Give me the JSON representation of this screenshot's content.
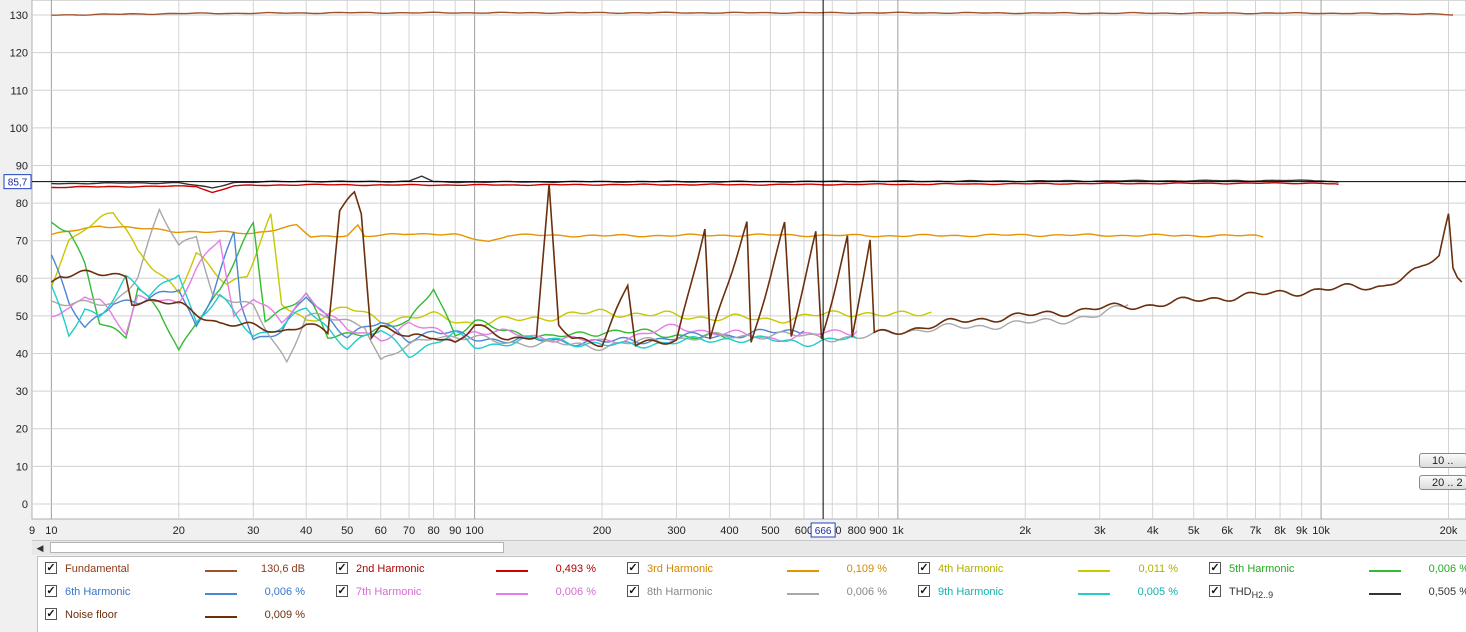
{
  "chart_data": {
    "type": "line",
    "x_scale": "log",
    "xlim": [
      9,
      22000
    ],
    "ylim": [
      -4,
      134
    ],
    "grid": true,
    "y_ticks": [
      "0",
      "10",
      "20",
      "30",
      "40",
      "50",
      "60",
      "70",
      "80",
      "90",
      "100",
      "110",
      "120",
      "130"
    ],
    "x_ticks": [
      "9",
      "10",
      "20",
      "30",
      "40",
      "50",
      "60",
      "70",
      "80",
      "90",
      "100",
      "200",
      "300",
      "400",
      "500",
      "600",
      "700",
      "800",
      "900",
      "1k",
      "2k",
      "3k",
      "4k",
      "5k",
      "6k",
      "7k",
      "8k",
      "9k",
      "10k",
      "20k"
    ],
    "cursor": {
      "x": 666,
      "y": 85.7,
      "x_label": "666",
      "y_label": "85,7"
    },
    "series": [
      {
        "name": "Fundamental",
        "color": "#a0522d",
        "value": "130,6 dB",
        "points": [
          [
            10,
            130
          ],
          [
            20,
            130.4
          ],
          [
            50,
            130.6
          ],
          [
            100,
            130.6
          ],
          [
            300,
            130.6
          ],
          [
            1000,
            130.6
          ],
          [
            3000,
            130.5
          ],
          [
            10000,
            130.5
          ],
          [
            18000,
            130.3
          ],
          [
            20500,
            130
          ]
        ]
      },
      {
        "name": "2nd Harmonic",
        "color": "#cc0000",
        "value": "0,493 %",
        "points": [
          [
            10,
            84.2
          ],
          [
            15,
            84.4
          ],
          [
            22,
            84.5
          ],
          [
            24,
            82.8
          ],
          [
            27,
            84.6
          ],
          [
            40,
            84.9
          ],
          [
            60,
            84.8
          ],
          [
            100,
            84.8
          ],
          [
            200,
            84.9
          ],
          [
            500,
            84.9
          ],
          [
            1000,
            85
          ],
          [
            3000,
            85.2
          ],
          [
            10000,
            85.3
          ],
          [
            11000,
            85
          ]
        ]
      },
      {
        "name": "3rd Harmonic",
        "color": "#e59400",
        "value": "0,109 %",
        "points": [
          [
            10,
            71.5
          ],
          [
            13,
            74
          ],
          [
            20,
            72.5
          ],
          [
            30,
            72
          ],
          [
            38,
            74
          ],
          [
            41,
            71
          ],
          [
            50,
            71.5
          ],
          [
            53,
            74
          ],
          [
            55,
            71
          ],
          [
            70,
            72
          ],
          [
            90,
            71.5
          ],
          [
            108,
            69.8
          ],
          [
            120,
            71.5
          ],
          [
            200,
            71.3
          ],
          [
            500,
            71.5
          ],
          [
            1000,
            71.3
          ],
          [
            2000,
            71.5
          ],
          [
            4000,
            71.4
          ],
          [
            7000,
            71.3
          ],
          [
            7300,
            71
          ]
        ]
      },
      {
        "name": "4th Harmonic",
        "color": "#c8c800",
        "value": "0,011 %",
        "points": [
          [
            10,
            58
          ],
          [
            11,
            70
          ],
          [
            12,
            74
          ],
          [
            14,
            77
          ],
          [
            15,
            73
          ],
          [
            16,
            67
          ],
          [
            18,
            62
          ],
          [
            20,
            56
          ],
          [
            22,
            66
          ],
          [
            26,
            59
          ],
          [
            29,
            61
          ],
          [
            33,
            76
          ],
          [
            35,
            53
          ],
          [
            40,
            49
          ],
          [
            50,
            52
          ],
          [
            60,
            49
          ],
          [
            80,
            50
          ],
          [
            100,
            48
          ],
          [
            200,
            51
          ],
          [
            300,
            50
          ],
          [
            500,
            49
          ],
          [
            800,
            51
          ],
          [
            1000,
            50
          ],
          [
            1200,
            51
          ]
        ]
      },
      {
        "name": "5th Harmonic",
        "color": "#33bb33",
        "value": "0,006 %",
        "points": [
          [
            10,
            75
          ],
          [
            11,
            73
          ],
          [
            12,
            63
          ],
          [
            13,
            48
          ],
          [
            15,
            45
          ],
          [
            16,
            58
          ],
          [
            18,
            51
          ],
          [
            20,
            40
          ],
          [
            22,
            49
          ],
          [
            25,
            57
          ],
          [
            30,
            74
          ],
          [
            32,
            49
          ],
          [
            40,
            56
          ],
          [
            45,
            44
          ],
          [
            55,
            46
          ],
          [
            70,
            48
          ],
          [
            80,
            58
          ],
          [
            90,
            45
          ],
          [
            100,
            48
          ],
          [
            150,
            44
          ],
          [
            200,
            46
          ],
          [
            300,
            45
          ],
          [
            400,
            44
          ]
        ]
      },
      {
        "name": "6th Harmonic",
        "color": "#4a86d6",
        "value": "0,006 %",
        "points": [
          [
            10,
            66
          ],
          [
            11,
            53
          ],
          [
            12,
            47
          ],
          [
            14,
            54
          ],
          [
            16,
            53
          ],
          [
            20,
            58
          ],
          [
            22,
            47
          ],
          [
            24,
            55
          ],
          [
            27,
            72
          ],
          [
            28,
            54
          ],
          [
            30,
            44
          ],
          [
            35,
            46
          ],
          [
            40,
            55
          ],
          [
            50,
            45
          ],
          [
            60,
            48
          ],
          [
            70,
            44
          ],
          [
            80,
            46
          ],
          [
            100,
            44
          ],
          [
            200,
            43
          ],
          [
            400,
            45
          ],
          [
            600,
            46
          ]
        ]
      },
      {
        "name": "7th Harmonic",
        "color": "#e87be8",
        "value": "0,006 %",
        "points": [
          [
            10,
            50
          ],
          [
            11,
            52
          ],
          [
            12,
            56
          ],
          [
            13,
            54
          ],
          [
            15,
            45
          ],
          [
            16,
            55
          ],
          [
            18,
            55
          ],
          [
            20,
            53
          ],
          [
            22,
            62
          ],
          [
            25,
            71
          ],
          [
            27,
            50
          ],
          [
            30,
            55
          ],
          [
            35,
            48
          ],
          [
            40,
            56
          ],
          [
            50,
            46
          ],
          [
            60,
            44
          ],
          [
            70,
            48
          ],
          [
            90,
            44
          ],
          [
            100,
            46
          ],
          [
            200,
            43
          ],
          [
            300,
            47
          ],
          [
            500,
            44
          ],
          [
            800,
            46
          ]
        ]
      },
      {
        "name": "8th Harmonic",
        "color": "#a8a8a8",
        "value": "0,006 %",
        "points": [
          [
            10,
            54
          ],
          [
            12,
            53
          ],
          [
            14,
            53
          ],
          [
            16,
            61
          ],
          [
            18,
            78
          ],
          [
            20,
            68
          ],
          [
            22,
            72
          ],
          [
            24,
            56
          ],
          [
            30,
            52
          ],
          [
            36,
            38
          ],
          [
            40,
            50
          ],
          [
            55,
            48
          ],
          [
            60,
            38
          ],
          [
            80,
            45
          ],
          [
            120,
            43
          ],
          [
            200,
            42
          ],
          [
            300,
            44
          ],
          [
            500,
            45
          ],
          [
            800,
            44
          ],
          [
            1000,
            46
          ],
          [
            2000,
            48
          ],
          [
            3000,
            50
          ],
          [
            3500,
            53
          ]
        ]
      },
      {
        "name": "9th Harmonic",
        "color": "#22cccc",
        "value": "0,005 %",
        "points": [
          [
            10,
            58
          ],
          [
            11,
            44
          ],
          [
            12,
            52
          ],
          [
            13,
            50
          ],
          [
            15,
            60
          ],
          [
            17,
            55
          ],
          [
            20,
            62
          ],
          [
            22,
            48
          ],
          [
            25,
            55
          ],
          [
            30,
            45
          ],
          [
            35,
            47
          ],
          [
            40,
            52
          ],
          [
            50,
            42
          ],
          [
            60,
            46
          ],
          [
            70,
            40
          ],
          [
            90,
            45
          ],
          [
            100,
            42
          ],
          [
            150,
            44
          ],
          [
            200,
            42
          ],
          [
            300,
            43
          ],
          [
            400,
            44
          ],
          [
            600,
            43
          ],
          [
            800,
            44
          ]
        ]
      },
      {
        "name": "THD",
        "name_sub": "H2..9",
        "color": "#333333",
        "value": "0,505 %",
        "points": [
          [
            10,
            85.2
          ],
          [
            20,
            85.4
          ],
          [
            24,
            84
          ],
          [
            27,
            85.5
          ],
          [
            40,
            85.8
          ],
          [
            50,
            85.7
          ],
          [
            70,
            85.8
          ],
          [
            75,
            87.2
          ],
          [
            80,
            85.6
          ],
          [
            100,
            85.6
          ],
          [
            200,
            85.7
          ],
          [
            500,
            85.7
          ],
          [
            1000,
            85.8
          ],
          [
            3000,
            85.9
          ],
          [
            10000,
            86
          ],
          [
            11000,
            85.6
          ]
        ]
      },
      {
        "name": "Noise floor",
        "color": "#6b2f0d",
        "value": "0,009 %",
        "points": [
          [
            10,
            59
          ],
          [
            10.5,
            61
          ],
          [
            15,
            61
          ],
          [
            15.5,
            54
          ],
          [
            20,
            53
          ],
          [
            22,
            51
          ],
          [
            25,
            48
          ],
          [
            30,
            47
          ],
          [
            35,
            46
          ],
          [
            40,
            48
          ],
          [
            45,
            45
          ],
          [
            48,
            78
          ],
          [
            52,
            83
          ],
          [
            54,
            78
          ],
          [
            57,
            45
          ],
          [
            60,
            47
          ],
          [
            70,
            44
          ],
          [
            80,
            45
          ],
          [
            90,
            43
          ],
          [
            100,
            47
          ],
          [
            120,
            44
          ],
          [
            140,
            45
          ],
          [
            150,
            84
          ],
          [
            158,
            47
          ],
          [
            170,
            44
          ],
          [
            200,
            43
          ],
          [
            230,
            58
          ],
          [
            240,
            42
          ],
          [
            300,
            44
          ],
          [
            350,
            73
          ],
          [
            360,
            43
          ],
          [
            440,
            75
          ],
          [
            450,
            43
          ],
          [
            540,
            74
          ],
          [
            560,
            44
          ],
          [
            640,
            72
          ],
          [
            660,
            44
          ],
          [
            760,
            71
          ],
          [
            780,
            44
          ],
          [
            860,
            70
          ],
          [
            880,
            45
          ],
          [
            1000,
            46
          ],
          [
            1500,
            49
          ],
          [
            2000,
            50
          ],
          [
            3000,
            52
          ],
          [
            4000,
            53
          ],
          [
            6000,
            55
          ],
          [
            8000,
            56
          ],
          [
            10000,
            57
          ],
          [
            14000,
            58
          ],
          [
            17000,
            62
          ],
          [
            19000,
            66
          ],
          [
            20000,
            77
          ],
          [
            20500,
            63
          ],
          [
            21500,
            59
          ]
        ]
      }
    ]
  },
  "buttons": {
    "b1": "10 ..",
    "b2": "20 .. 2"
  },
  "legend": [
    {
      "name": "Fundamental",
      "value": "130,6 dB",
      "color": "#a0522d"
    },
    {
      "name": "2nd Harmonic",
      "value": "0,493 %",
      "color": "#cc0000"
    },
    {
      "name": "3rd Harmonic",
      "value": "0,109 %",
      "color": "#e59400"
    },
    {
      "name": "4th Harmonic",
      "value": "0,011 %",
      "color": "#c8c800"
    },
    {
      "name": "5th Harmonic",
      "value": "0,006 %",
      "color": "#33bb33"
    },
    {
      "name": "6th Harmonic",
      "value": "0,006 %",
      "color": "#4a86d6"
    },
    {
      "name": "7th Harmonic",
      "value": "0,006 %",
      "color": "#e87be8"
    },
    {
      "name": "8th Harmonic",
      "value": "0,006 %",
      "color": "#888888"
    },
    {
      "name": "9th Harmonic",
      "value": "0,005 %",
      "color": "#22cccc"
    },
    {
      "name": "THD",
      "sub": "H2..9",
      "value": "0,505 %",
      "color": "#333333"
    },
    {
      "name": "Noise floor",
      "value": "0,009 %",
      "color": "#6b2f0d"
    }
  ]
}
